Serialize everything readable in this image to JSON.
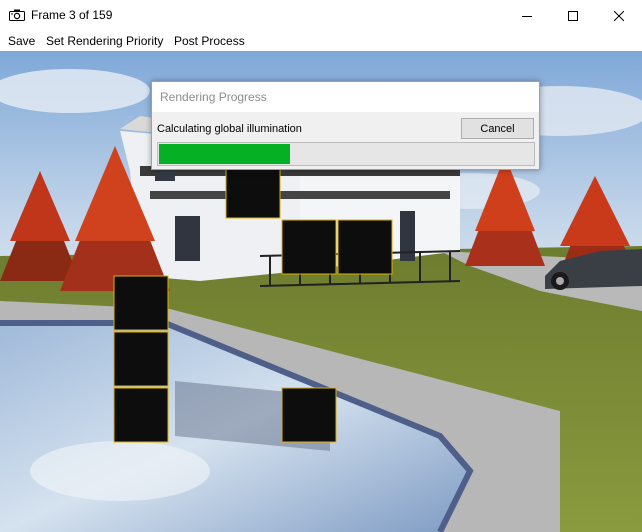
{
  "window": {
    "title": "Frame 3 of 159",
    "app_icon": "camera-icon",
    "controls": [
      "minimize-icon",
      "maximize-icon",
      "close-icon"
    ]
  },
  "menu": {
    "save": "Save",
    "set_rendering_priority": "Set Rendering Priority",
    "post_process": "Post Process"
  },
  "dialog": {
    "title": "Rendering Progress",
    "status": "Calculating global illumination",
    "cancel_label": "Cancel",
    "progress_fraction": 0.35
  },
  "colors": {
    "progress_fill": "#06b025",
    "tile_border": "#e0b000",
    "tile_fill": "#0d0d0d"
  }
}
